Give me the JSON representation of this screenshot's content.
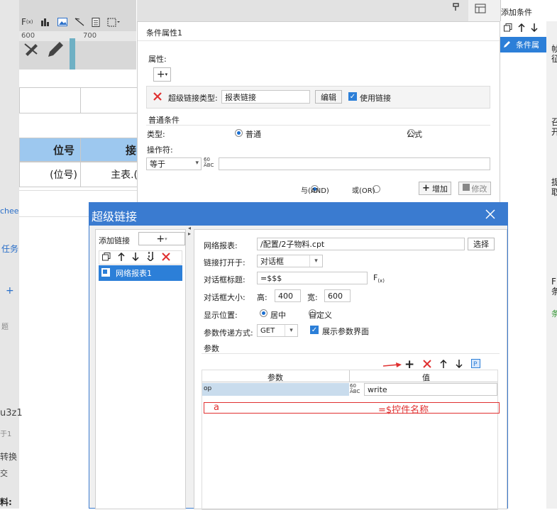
{
  "toolbar": {
    "ruler_marks": [
      "600",
      "700"
    ]
  },
  "sheet": {
    "header_col1": "位号",
    "header_col2": "接",
    "row1_col1": "(位号)",
    "row1_col2": "主表.(",
    "side_texts": [
      "chee",
      "任务",
      "+",
      "题",
      "u3z1",
      "于1",
      "转换",
      "交",
      "料:"
    ]
  },
  "right_pane": {
    "add_condition": "添加条件",
    "condition_item": "条件属",
    "fragments": [
      "帧",
      "征",
      "召",
      "开",
      "提",
      "取",
      "F",
      "条",
      "条"
    ]
  },
  "condition": {
    "title": "条件属性1",
    "attr_label": "属性:",
    "link_type_label": "超级链接类型:",
    "link_type_value": "报表链接",
    "edit_button": "编辑",
    "use_link_label": "使用链接",
    "normal_section": "普通条件",
    "type_label": "类型:",
    "type_normal": "普通",
    "type_formula": "公式",
    "operator_label": "操作符:",
    "operator_value": "等于",
    "and_label": "与(AND)",
    "or_label": "或(OR)",
    "add_button": "增加",
    "modify_button": "修改"
  },
  "dialog": {
    "title": "超级链接",
    "add_link_label": "添加链接",
    "tree_item": "网络报表1",
    "net_report_label": "网络报表:",
    "net_report_value": "/配置/2子物料.cpt",
    "select_button": "选择",
    "open_in_label": "链接打开于:",
    "open_in_value": "对话框",
    "dialog_title_label": "对话框标题:",
    "dialog_title_value": "=$$$",
    "dialog_size_label": "对话框大小:",
    "height_label": "高:",
    "height_value": "400",
    "width_label": "宽:",
    "width_value": "600",
    "position_label": "显示位置:",
    "position_center": "居中",
    "position_custom": "自定义",
    "param_method_label": "参数传递方式:",
    "param_method_value": "GET",
    "show_params_label": "展示参数界面",
    "params_section": "参数",
    "col_param": "参数",
    "col_value": "值",
    "param_row_name": "op",
    "param_row_value": "write",
    "annotation_left": "a",
    "annotation_right": "=$控件名称"
  },
  "colors": {
    "accent": "#3a7bd0",
    "header_blue": "#9dc8ef",
    "annotation_red": "#e03030"
  }
}
